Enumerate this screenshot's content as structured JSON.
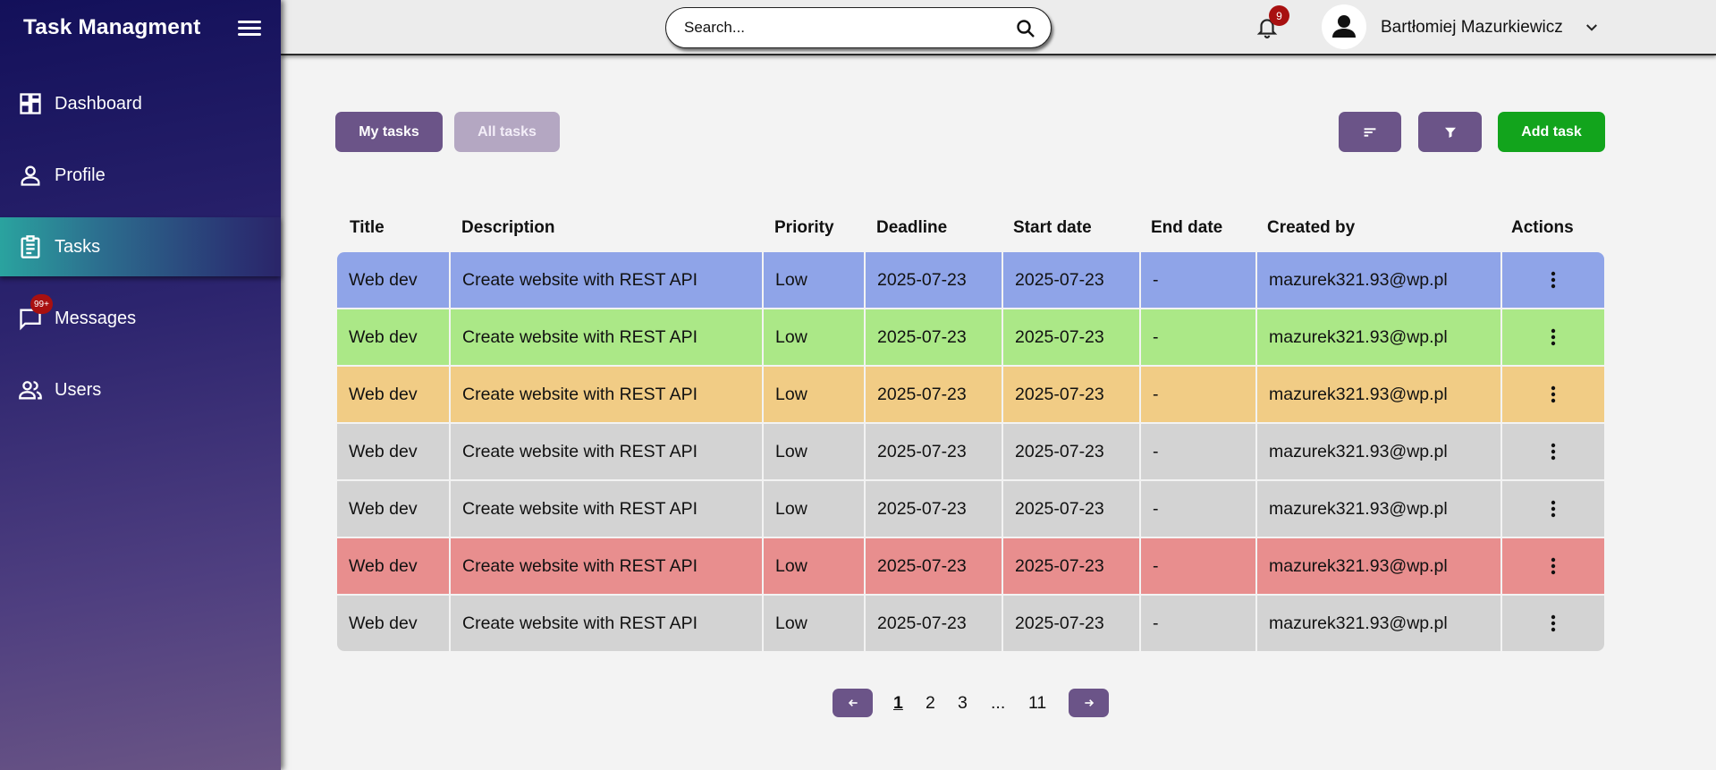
{
  "sidebar": {
    "brand": "Task Managment",
    "items": [
      {
        "label": "Dashboard",
        "icon": "dashboard-icon"
      },
      {
        "label": "Profile",
        "icon": "person-icon"
      },
      {
        "label": "Tasks",
        "icon": "clipboard-icon",
        "active": true
      },
      {
        "label": "Messages",
        "icon": "chat-icon",
        "badge": "99+"
      },
      {
        "label": "Users",
        "icon": "group-icon"
      }
    ]
  },
  "header": {
    "search_placeholder": "Search...",
    "notifications_count": "9",
    "user_name": "Bartłomiej Mazurkiewicz"
  },
  "toolbar": {
    "my_tasks": "My tasks",
    "all_tasks": "All tasks",
    "add_task": "Add task"
  },
  "table": {
    "columns": [
      "Title",
      "Description",
      "Priority",
      "Deadline",
      "Start date",
      "End date",
      "Created by",
      "Actions"
    ],
    "rows": [
      {
        "title": "Web dev",
        "description": "Create website with REST API",
        "priority": "Low",
        "deadline": "2025-07-23",
        "start_date": "2025-07-23",
        "end_date": "-",
        "created_by": "mazurek321.93@wp.pl",
        "color": "#8fa4e8"
      },
      {
        "title": "Web dev",
        "description": "Create website with REST API",
        "priority": "Low",
        "deadline": "2025-07-23",
        "start_date": "2025-07-23",
        "end_date": "-",
        "created_by": "mazurek321.93@wp.pl",
        "color": "#abe887"
      },
      {
        "title": "Web dev",
        "description": "Create website with REST API",
        "priority": "Low",
        "deadline": "2025-07-23",
        "start_date": "2025-07-23",
        "end_date": "-",
        "created_by": "mazurek321.93@wp.pl",
        "color": "#f1cc85"
      },
      {
        "title": "Web dev",
        "description": "Create website with REST API",
        "priority": "Low",
        "deadline": "2025-07-23",
        "start_date": "2025-07-23",
        "end_date": "-",
        "created_by": "mazurek321.93@wp.pl",
        "color": "#d3d3d3"
      },
      {
        "title": "Web dev",
        "description": "Create website with REST API",
        "priority": "Low",
        "deadline": "2025-07-23",
        "start_date": "2025-07-23",
        "end_date": "-",
        "created_by": "mazurek321.93@wp.pl",
        "color": "#d3d3d3"
      },
      {
        "title": "Web dev",
        "description": "Create website with REST API",
        "priority": "Low",
        "deadline": "2025-07-23",
        "start_date": "2025-07-23",
        "end_date": "-",
        "created_by": "mazurek321.93@wp.pl",
        "color": "#e88e8e"
      },
      {
        "title": "Web dev",
        "description": "Create website with REST API",
        "priority": "Low",
        "deadline": "2025-07-23",
        "start_date": "2025-07-23",
        "end_date": "-",
        "created_by": "mazurek321.93@wp.pl",
        "color": "#d3d3d3"
      }
    ]
  },
  "pagination": {
    "pages": [
      "1",
      "2",
      "3",
      "...",
      "11"
    ],
    "current": "1"
  },
  "colors": {
    "accent": "#6b5488",
    "add_button": "#12a41c",
    "badge": "#a81010"
  }
}
